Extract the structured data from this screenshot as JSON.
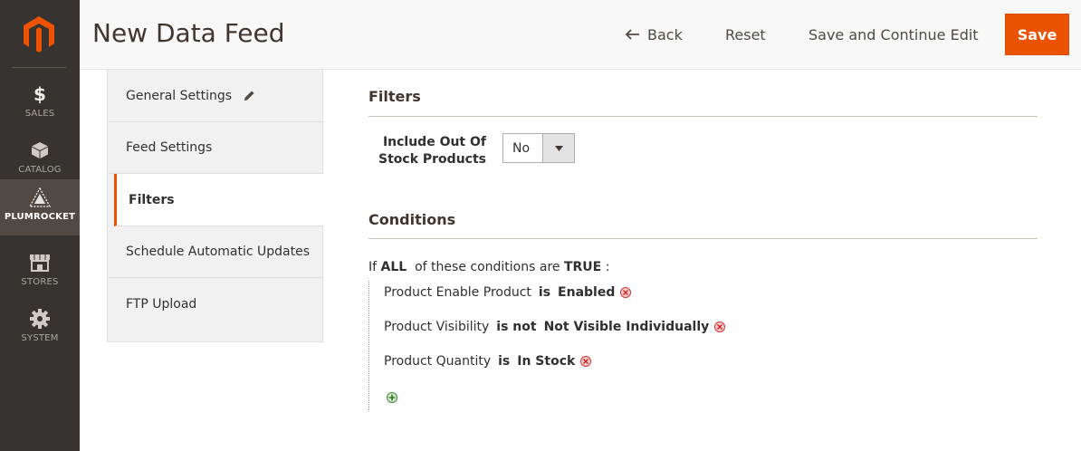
{
  "nav": {
    "items": [
      {
        "label": "SALES",
        "icon": "dollar-icon"
      },
      {
        "label": "CATALOG",
        "icon": "box-icon"
      },
      {
        "label": "PLUMROCKET",
        "icon": "plumrocket-icon"
      },
      {
        "label": "STORES",
        "icon": "store-icon"
      },
      {
        "label": "SYSTEM",
        "icon": "gear-icon"
      }
    ],
    "active": "PLUMROCKET"
  },
  "header": {
    "title": "New Data Feed",
    "back_label": "Back",
    "reset_label": "Reset",
    "save_continue_label": "Save and Continue Edit",
    "save_label": "Save"
  },
  "tabs": [
    {
      "label": "General Settings"
    },
    {
      "label": "Feed Settings"
    },
    {
      "label": "Filters"
    },
    {
      "label": "Schedule Automatic Updates"
    },
    {
      "label": "FTP Upload"
    }
  ],
  "filters": {
    "title": "Filters",
    "include_out_of_stock_label": "Include Out Of Stock Products",
    "include_out_of_stock_value": "No"
  },
  "conditions": {
    "title": "Conditions",
    "intro_prefix": "If",
    "aggregator": "ALL",
    "intro_middle": "of these conditions are",
    "value": "TRUE",
    "intro_suffix": ":",
    "rows": [
      {
        "attribute": "Product Enable Product",
        "operator": "is",
        "value": "Enabled"
      },
      {
        "attribute": "Product Visibility",
        "operator": "is not",
        "value": "Not Visible Individually"
      },
      {
        "attribute": "Product Quantity",
        "operator": "is",
        "value": "In Stock"
      }
    ]
  },
  "colors": {
    "accent": "#eb5202",
    "nav_bg": "#373330",
    "nav_active": "#514943"
  }
}
